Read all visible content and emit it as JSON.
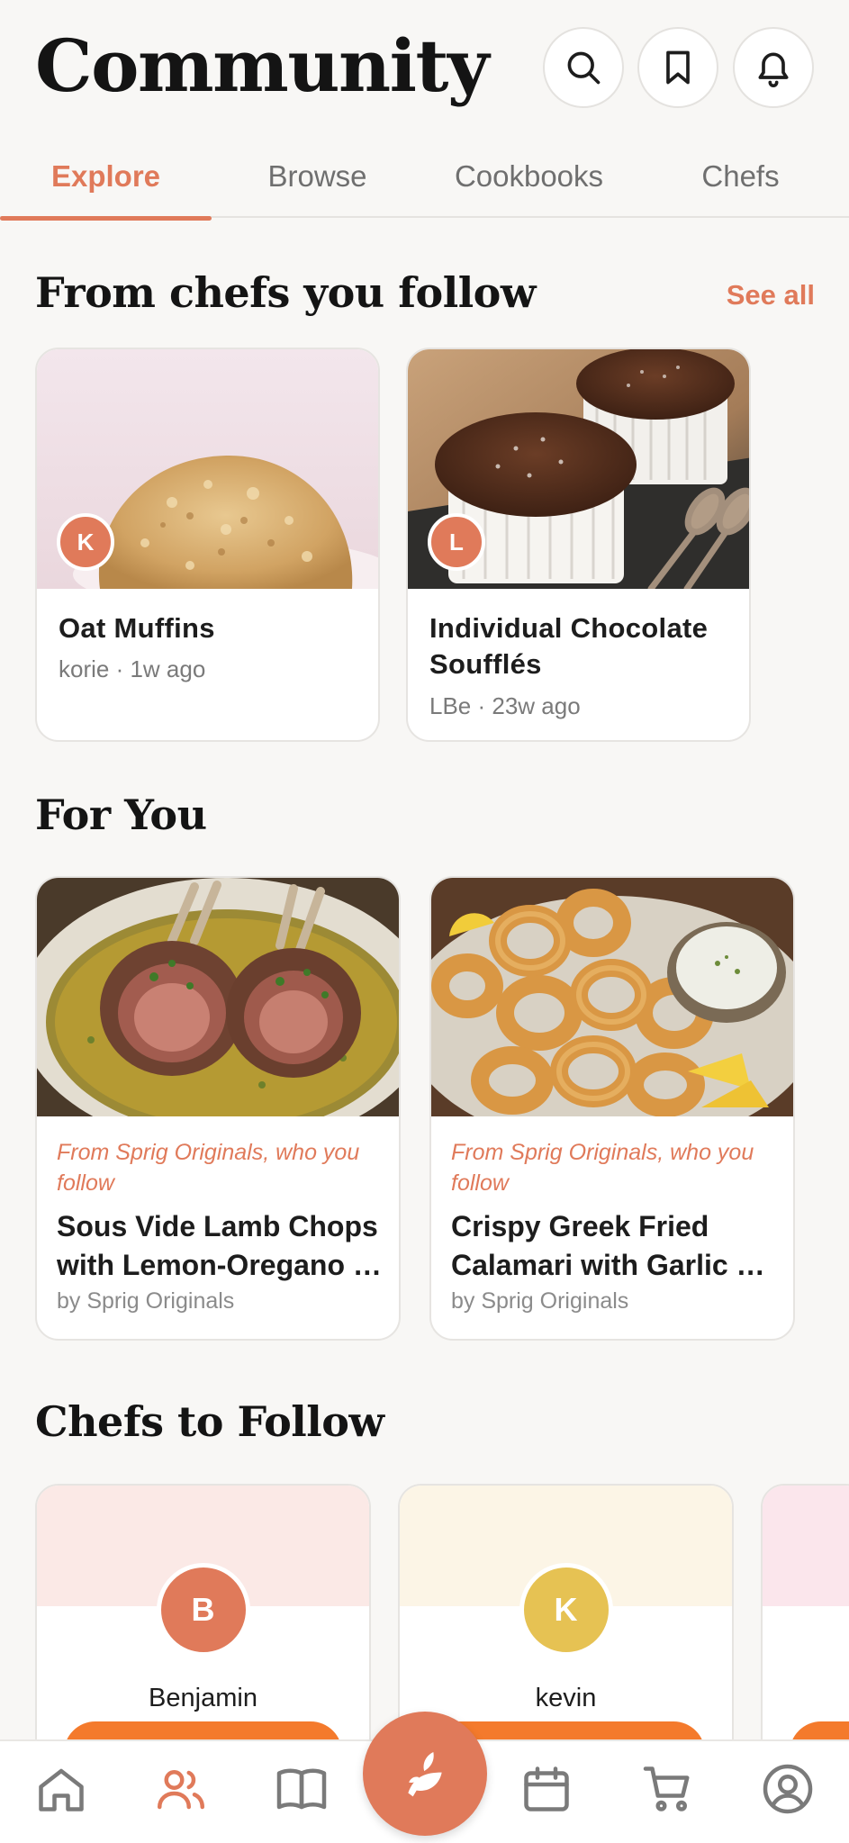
{
  "header": {
    "title": "Community",
    "icons": [
      "search-icon",
      "bookmark-icon",
      "bell-icon"
    ]
  },
  "tabs": [
    {
      "label": "Explore",
      "active": true
    },
    {
      "label": "Browse",
      "active": false
    },
    {
      "label": "Cookbooks",
      "active": false
    },
    {
      "label": "Chefs",
      "active": false
    }
  ],
  "following": {
    "title": "From chefs you follow",
    "see_all": "See all",
    "cards": [
      {
        "title": "Oat Muffins",
        "meta": "korie · 1w ago",
        "avatar": "K"
      },
      {
        "title": "Individual Chocolate Soufflés",
        "meta": "LBe · 23w ago",
        "avatar": "L"
      }
    ]
  },
  "for_you": {
    "title": "For You",
    "cards": [
      {
        "reason": "From Sprig Originals, who you follow",
        "title_line1": "Sous Vide Lamb Chops",
        "title_line2": "with Lemon-Oregano …",
        "by": "by Sprig Originals"
      },
      {
        "reason": "From Sprig Originals, who you follow",
        "title_line1": "Crispy Greek Fried",
        "title_line2": "Calamari with Garlic …",
        "by": "by Sprig Originals"
      }
    ]
  },
  "chefs": {
    "title": "Chefs to Follow",
    "cards": [
      {
        "name": "Benjamin",
        "initial": "B",
        "avatar_color": "#e07a5a",
        "banner_color": "#fbe9e6"
      },
      {
        "name": "kevin",
        "initial": "K",
        "avatar_color": "#e6c253",
        "banner_color": "#fcf5e6"
      }
    ]
  },
  "bottom_nav": {
    "items": [
      "home-icon",
      "community-icon",
      "book-icon",
      "sprig-icon",
      "calendar-icon",
      "cart-icon",
      "profile-icon"
    ],
    "active": "community-icon"
  },
  "colors": {
    "accent": "#e07a5a",
    "follow_button": "#f47a2c",
    "background": "#f8f7f5"
  }
}
